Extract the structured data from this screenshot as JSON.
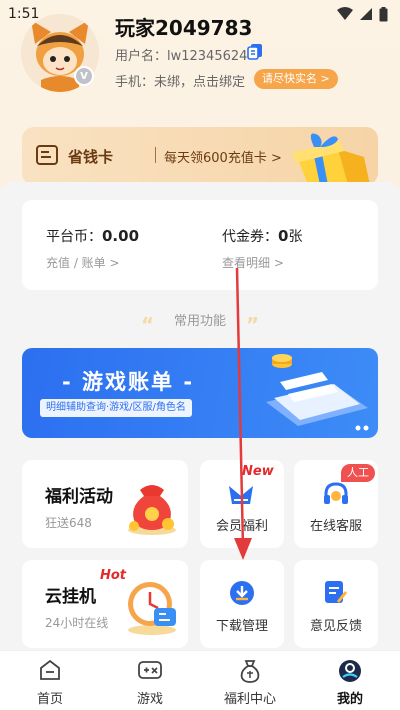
{
  "status_bar": {
    "time": "1:51"
  },
  "profile": {
    "nickname": "玩家2049783",
    "username": "用户名：lw12345624",
    "phone": "手机：未绑，点击绑定",
    "verify_badge": "请尽快实名 >",
    "vip_badge": "V"
  },
  "money_card": {
    "title": "省钱卡",
    "subtitle": "每天领600充值卡 >"
  },
  "wallet": {
    "platform_coin_label": "平台币：",
    "platform_coin_value": "0.00",
    "recharge_link": "充值 / 账单 >",
    "voucher_label": "代金券：",
    "voucher_value": "0",
    "voucher_unit": "张",
    "detail_link": "查看明细 >"
  },
  "section_title": "常用功能",
  "banner": {
    "title": "- 游戏账单 -",
    "subtitle": "明细辅助查询·游戏/区服/角色名"
  },
  "features": {
    "welfare": {
      "title": "福利活动",
      "subtitle": "狂送648"
    },
    "vip_welfare": {
      "label": "会员福利",
      "tag": "New"
    },
    "service": {
      "label": "在线客服",
      "tag": "人工"
    },
    "cloud": {
      "title": "云挂机",
      "subtitle": "24小时在线",
      "tag": "Hot"
    },
    "download": {
      "label": "下载管理"
    },
    "feedback": {
      "label": "意见反馈"
    }
  },
  "bottom_nav": [
    {
      "label": "首页",
      "icon": "home-icon"
    },
    {
      "label": "游戏",
      "icon": "gamepad-icon"
    },
    {
      "label": "福利中心",
      "icon": "money-bag-icon"
    },
    {
      "label": "我的",
      "icon": "user-icon",
      "active": true
    }
  ],
  "colors": {
    "accent_blue": "#2c6ff0",
    "accent_orange": "#f7a54a",
    "card_gold": "#f6d4a6",
    "tag_red": "#e32b2b"
  }
}
